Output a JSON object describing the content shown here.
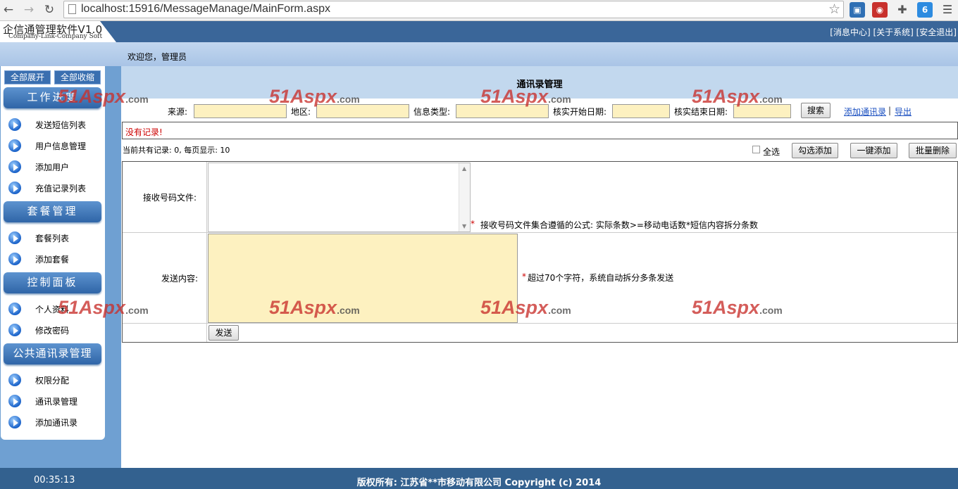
{
  "browser": {
    "url": "localhost:15916/MessageManage/MainForm.aspx"
  },
  "header": {
    "app_title": "企信通管理软件V1.0",
    "app_subtitle": "Company-Link-Company Soft",
    "links": "[消息中心] [关于系统] [安全退出]",
    "welcome": "欢迎您，管理员"
  },
  "sidebar": {
    "expand_all": "全部展开",
    "collapse_all": "全部收缩",
    "groups": [
      {
        "title": "工作进度",
        "items": [
          "发送短信列表",
          "用户信息管理",
          "添加用户",
          "充值记录列表"
        ]
      },
      {
        "title": "套餐管理",
        "items": [
          "套餐列表",
          "添加套餐"
        ]
      },
      {
        "title": "控制面板",
        "items": [
          "个人资料",
          "修改密码"
        ]
      },
      {
        "title": "公共通讯录管理",
        "items": [
          "权限分配",
          "通讯录管理",
          "添加通讯录"
        ]
      }
    ]
  },
  "main": {
    "title": "通讯录管理",
    "filters": {
      "source": "来源:",
      "region": "地区:",
      "info_type": "信息类型:",
      "start_date": "核实开始日期:",
      "end_date": "核实结束日期:",
      "search": "搜索",
      "add_contact": "添加通讯录",
      "sep": "|",
      "export": "导出"
    },
    "no_records": "没有记录!",
    "count_text": "当前共有记录: 0, 每页显示: 10",
    "select_all": "全选",
    "check_add": "勾选添加",
    "one_click_add": "一键添加",
    "batch_delete": "批量删除",
    "form": {
      "recv_label": "接收号码文件:",
      "recv_hint_star": "*",
      "recv_hint": "接收号码文件集合遵循的公式: 实际条数>=移动电话数*短信内容拆分条数",
      "recv_value": "",
      "content_label": "发送内容:",
      "content_hint_star": "*",
      "content_hint": "超过70个字符，系统自动拆分多条发送",
      "content_value": "",
      "send": "发送"
    }
  },
  "watermark": {
    "brand": "51Aspx",
    "domain": ".com"
  },
  "footer": {
    "clock": "00:35:13",
    "copyright": "版权所有: 江苏省**市移动有限公司 Copyright (c) 2014"
  },
  "colors": {
    "header": "#3a6699",
    "footer": "#33618f",
    "input_bg": "#fdf1c0",
    "error": "#cc0000"
  }
}
